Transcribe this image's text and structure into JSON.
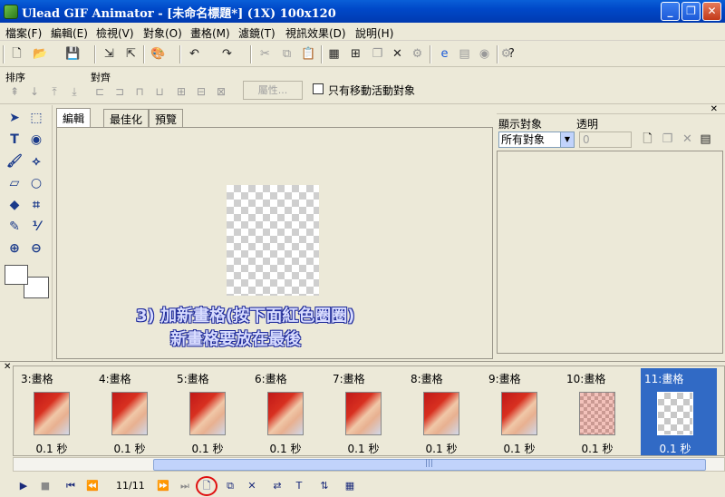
{
  "window": {
    "title": "Ulead GIF Animator - [未命名標題*] (1X) 100x120",
    "controls": [
      "_",
      "❐",
      "✕"
    ]
  },
  "menu": [
    "檔案(F)",
    "編輯(E)",
    "檢視(V)",
    "對象(O)",
    "畫格(M)",
    "濾鏡(T)",
    "視訊效果(D)",
    "說明(H)"
  ],
  "toolbar2": {
    "sort_label": "排序",
    "align_label": "對齊",
    "properties_button": "屬性...",
    "only_movable_label": "只有移動活動對象"
  },
  "tabs": [
    "編輯",
    "最佳化",
    "預覽"
  ],
  "annotation": {
    "line1": "3) 加新畫格(按下面紅色圈圈)",
    "line2": "新畫格要放在最後"
  },
  "object_manager": {
    "display_label": "顯示對象",
    "opacity_label": "透明",
    "display_value": "所有對象",
    "opacity_value": "0"
  },
  "frames": [
    {
      "name": "3:畫格",
      "delay": "0.1 秒",
      "kind": "photo"
    },
    {
      "name": "4:畫格",
      "delay": "0.1 秒",
      "kind": "photo"
    },
    {
      "name": "5:畫格",
      "delay": "0.1 秒",
      "kind": "photo"
    },
    {
      "name": "6:畫格",
      "delay": "0.1 秒",
      "kind": "photo"
    },
    {
      "name": "7:畫格",
      "delay": "0.1 秒",
      "kind": "photo"
    },
    {
      "name": "8:畫格",
      "delay": "0.1 秒",
      "kind": "photo"
    },
    {
      "name": "9:畫格",
      "delay": "0.1 秒",
      "kind": "photo"
    },
    {
      "name": "10:畫格",
      "delay": "0.1 秒",
      "kind": "faded"
    },
    {
      "name": "11:畫格",
      "delay": "0.1 秒",
      "kind": "blank",
      "selected": true
    }
  ],
  "playback": {
    "frame_counter": "11/11"
  },
  "colors": {
    "titlebar": "#0048c8",
    "selected_frame": "#316ac5",
    "highlight_circle": "#e01010",
    "annotation_text": "#d8dcff"
  }
}
